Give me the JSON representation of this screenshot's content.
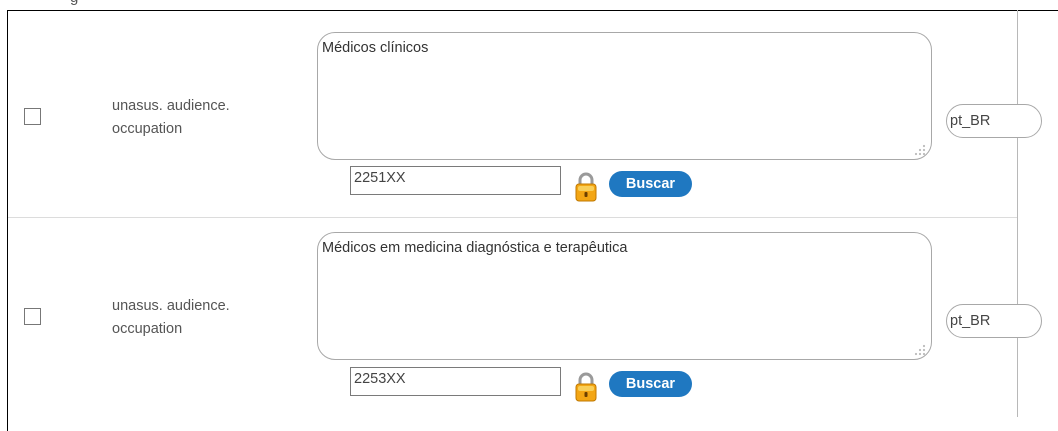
{
  "header": {
    "clipped_text": "g"
  },
  "rows": [
    {
      "label_line1": "unasus. audience.",
      "label_line2": "occupation",
      "value": "Médicos clínicos",
      "code": "2251XX",
      "search_label": "Buscar",
      "language": "pt_BR"
    },
    {
      "label_line1": "unasus. audience.",
      "label_line2": "occupation",
      "value": "Médicos em medicina diagnóstica e terapêutica",
      "code": "2253XX",
      "search_label": "Buscar",
      "language": "pt_BR"
    }
  ],
  "colors": {
    "button": "#1f78c1",
    "lock": "#f3a614"
  }
}
